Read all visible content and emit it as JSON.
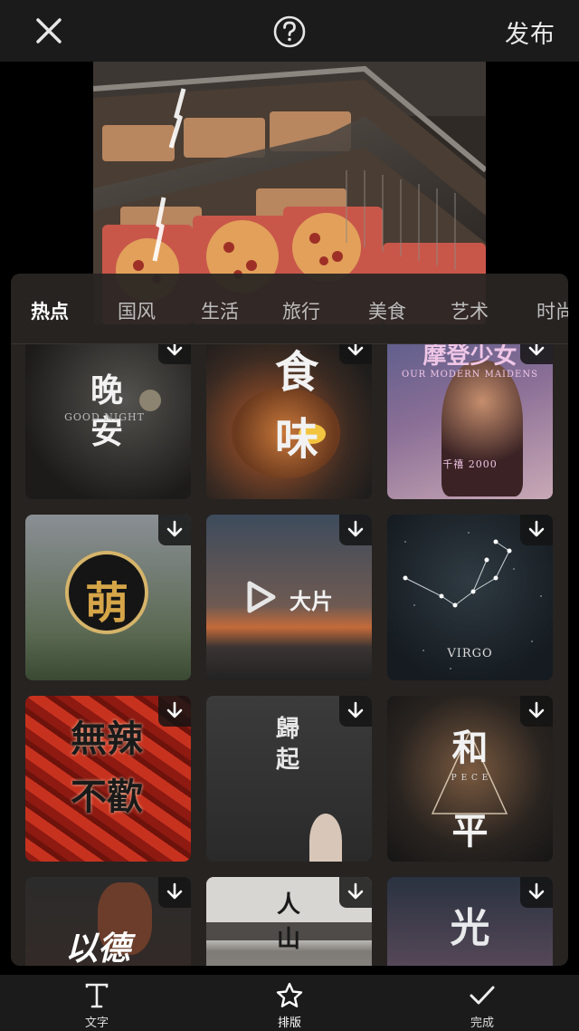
{
  "topbar": {
    "publish_label": "发布"
  },
  "tabs": [
    {
      "label": "热点",
      "active": true
    },
    {
      "label": "国风"
    },
    {
      "label": "生活"
    },
    {
      "label": "旅行"
    },
    {
      "label": "美食"
    },
    {
      "label": "艺术"
    },
    {
      "label": "时尚"
    }
  ],
  "templates": [
    {
      "title": "晚\n安",
      "subtitle": "GOOD NIGHT"
    },
    {
      "title": "食\n味",
      "subtitle": ""
    },
    {
      "title": "摩登少女",
      "subtitle": "OUR MODERN MAIDENS",
      "caption": "千禧 2000"
    },
    {
      "title": "萌",
      "subtitle": ""
    },
    {
      "title": "大片",
      "subtitle": ""
    },
    {
      "title": "",
      "subtitle": "VIRGO"
    },
    {
      "title": "無辣\n不歡",
      "subtitle": ""
    },
    {
      "title": "歸起",
      "subtitle": ""
    },
    {
      "title": "和\n平",
      "subtitle": "P E C E"
    },
    {
      "title": "以德",
      "subtitle": ""
    },
    {
      "title": "人\n山",
      "subtitle": ""
    },
    {
      "title": "光",
      "subtitle": ""
    }
  ],
  "bottombar": {
    "text_label": "文字",
    "layout_label": "排版",
    "done_label": "完成"
  },
  "colors": {
    "accent": "#ffffff",
    "panel": "#282523",
    "bar": "#1b1b1b"
  }
}
